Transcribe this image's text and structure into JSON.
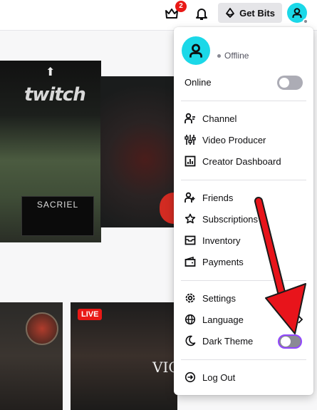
{
  "topbar": {
    "crown_badge_count": "2",
    "get_bits_label": "Get Bits"
  },
  "background": {
    "video1_logo": "twitch",
    "video1_channel": "SACRIEL",
    "live_label": "LIVE",
    "video4_text": "VIC"
  },
  "menu": {
    "status": "Offline",
    "online_label": "Online",
    "items_group1": [
      {
        "label": "Channel",
        "icon": "channel-icon"
      },
      {
        "label": "Video Producer",
        "icon": "video-producer-icon"
      },
      {
        "label": "Creator Dashboard",
        "icon": "dashboard-icon"
      }
    ],
    "items_group2": [
      {
        "label": "Friends",
        "icon": "friends-icon"
      },
      {
        "label": "Subscriptions",
        "icon": "star-icon"
      },
      {
        "label": "Inventory",
        "icon": "inventory-icon"
      },
      {
        "label": "Payments",
        "icon": "wallet-icon"
      }
    ],
    "items_group3": [
      {
        "label": "Settings",
        "icon": "gear-icon"
      },
      {
        "label": "Language",
        "icon": "globe-icon"
      },
      {
        "label": "Dark Theme",
        "icon": "moon-icon"
      }
    ],
    "logout_label": "Log Out",
    "online_toggle_on": false,
    "dark_theme_toggle_on": false
  },
  "colors": {
    "accent_purple": "#9147ff",
    "avatar_cyan": "#1bd8e8",
    "badge_red": "#e91916",
    "annotation_red": "#e8141b"
  }
}
